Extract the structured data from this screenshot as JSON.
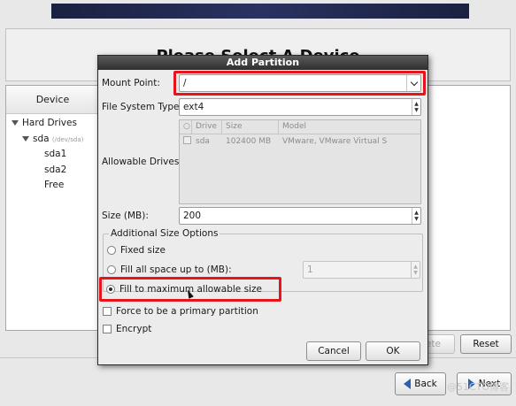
{
  "installer": {
    "page_title": "Please Select A Device",
    "tree": {
      "column_header": "Device",
      "root_label": "Hard Drives",
      "disk_label": "sda",
      "disk_path": "(/dev/sda)",
      "items": [
        "sda1",
        "sda2",
        "Free"
      ]
    },
    "buttons": {
      "delete_label": "lete",
      "reset_label": "Reset",
      "back_label": "Back",
      "next_label": "Next"
    }
  },
  "dialog": {
    "title": "Add Partition",
    "mount_point": {
      "label": "Mount Point:",
      "value": "/"
    },
    "file_system_type": {
      "label": "File System Type:",
      "value": "ext4"
    },
    "allowable_drives": {
      "label": "Allowable Drives:",
      "columns": [
        "Drive",
        "Size",
        "Model"
      ],
      "rows": [
        {
          "drive": "sda",
          "size": "102400 MB",
          "model": "VMware, VMware Virtual S",
          "checked": true
        }
      ]
    },
    "size": {
      "label": "Size (MB):",
      "value": "200"
    },
    "additional_size_options": {
      "legend": "Additional Size Options",
      "fixed_size": "Fixed size",
      "fill_up_to": "Fill all space up to (MB):",
      "fill_up_to_value": "1",
      "fill_max": "Fill to maximum allowable size",
      "selected": "fill_max"
    },
    "force_primary": {
      "label": "Force to be a primary partition",
      "checked": false
    },
    "encrypt": {
      "label": "Encrypt",
      "checked": false
    },
    "cancel_label": "Cancel",
    "ok_label": "OK"
  },
  "watermark": "@51CTO博客",
  "colors": {
    "highlight": "#e8141c",
    "dialog_title_bg": "#3a3a3a",
    "banner": "#1b2140",
    "nav_arrow": "#2f5fb0"
  }
}
